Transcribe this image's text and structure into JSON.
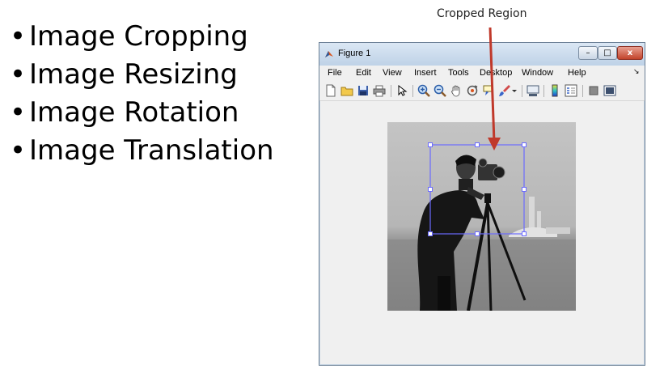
{
  "slide": {
    "bullets": [
      "Image Cropping",
      "Image Resizing",
      "Image Rotation",
      "Image Translation"
    ],
    "bullet_glyph": "•"
  },
  "annotation": {
    "label": "Cropped Region",
    "arrow_color": "#c0392b"
  },
  "window": {
    "title": "Figure 1",
    "controls": {
      "minimize": "–",
      "maximize": "□",
      "close": "x"
    },
    "menu": [
      "File",
      "Edit",
      "View",
      "Insert",
      "Tools",
      "Desktop",
      "Window",
      "Help"
    ],
    "menu_pin": "↘",
    "toolbar_icons": [
      "new-figure-icon",
      "open-file-icon",
      "save-icon",
      "print-icon",
      "select-arrow-icon",
      "zoom-in-icon",
      "zoom-out-icon",
      "pan-hand-icon",
      "rotate-3d-icon",
      "data-cursor-icon",
      "brush-icon",
      "link-plot-icon",
      "colorbar-icon",
      "legend-icon",
      "hide-plot-tools-icon",
      "show-plot-tools-icon"
    ],
    "image": {
      "subject": "cameraman grayscale image",
      "crop_selection_color": "#6b6bff"
    }
  }
}
